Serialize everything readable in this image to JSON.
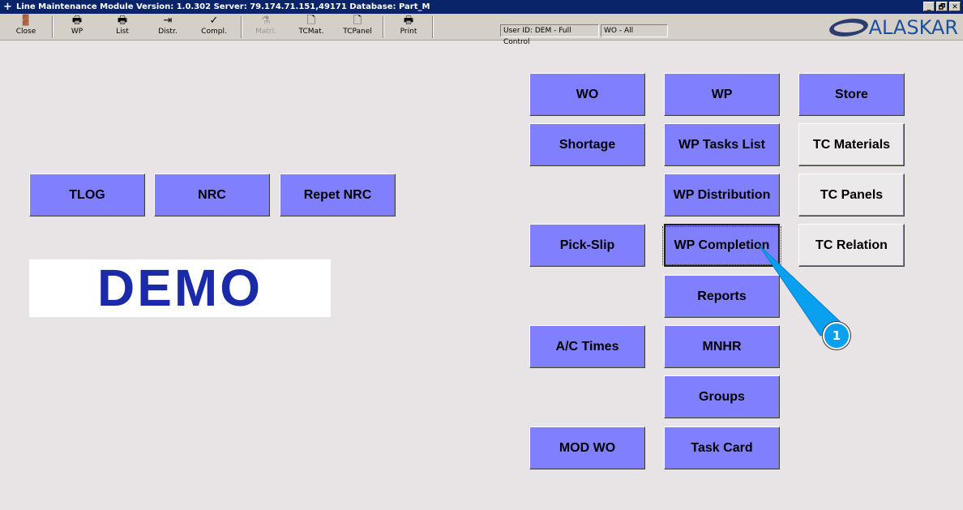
{
  "window": {
    "title": "Line Maintenance Module  Version: 1.0.302 Server: 79.174.71.151,49171 Database: Part_M",
    "controls": [
      "_",
      "🗗",
      "✕"
    ]
  },
  "toolbar": [
    {
      "label": "Close",
      "icon": "door-exit-icon",
      "glyph": "🚪",
      "enabled": true
    },
    {
      "label": "WP",
      "icon": "printer-folder-icon",
      "glyph": "🖶",
      "enabled": true
    },
    {
      "label": "List",
      "icon": "printer-folder-icon",
      "glyph": "🖶",
      "enabled": true
    },
    {
      "label": "Distr.",
      "icon": "distribute-icon",
      "glyph": "⇥",
      "enabled": true
    },
    {
      "label": "Compl.",
      "icon": "complete-icon",
      "glyph": "✓",
      "enabled": true
    },
    {
      "label": "Matrl.",
      "icon": "flask-icon",
      "glyph": "⚗",
      "enabled": false
    },
    {
      "label": "TCMat.",
      "icon": "document-icon",
      "glyph": "🗋",
      "enabled": true
    },
    {
      "label": "TCPanel",
      "icon": "document-icon",
      "glyph": "🗋",
      "enabled": true
    },
    {
      "label": "Print",
      "icon": "printer-icon",
      "glyph": "🖶",
      "enabled": true
    }
  ],
  "status": {
    "user": "User ID: DEM - Full Control",
    "wo": "WO - All"
  },
  "logo": "ALASKAR",
  "left_buttons": [
    "TLOG",
    "NRC",
    "Repet NRC"
  ],
  "demo": "DEMO",
  "col1": {
    "wo": "WO",
    "shortage": "Shortage",
    "pick": "Pick-Slip",
    "ac": "A/C Times",
    "mod": "MOD WO"
  },
  "col2": [
    "WP",
    "WP Tasks List",
    "WP Distribution",
    "WP Completion",
    "Reports",
    "MNHR",
    "Groups",
    "Task Card"
  ],
  "col3": [
    "Store",
    "TC Materials",
    "TC Panels",
    "TC Relation"
  ],
  "callout": "1",
  "colors": {
    "button": "#8080ff",
    "title": "#0a246a",
    "callout": "#0aa0f0"
  }
}
